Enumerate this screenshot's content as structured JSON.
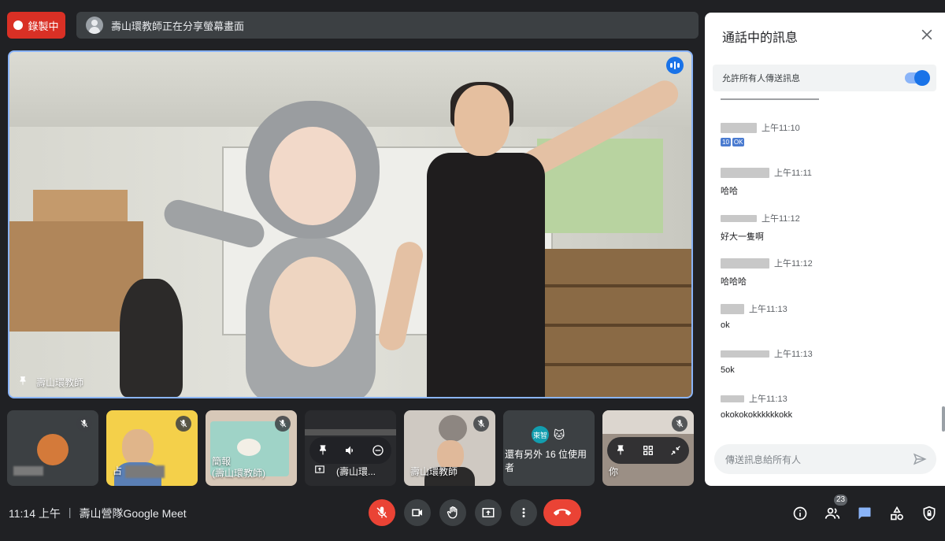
{
  "recording": {
    "label": "錄製中"
  },
  "share_banner": {
    "text": "壽山環教師正在分享螢幕畫面"
  },
  "main_video": {
    "participant": "壽山環教師"
  },
  "thumbnails": [
    {
      "label": ""
    },
    {
      "label": "占"
    },
    {
      "label": "簡報\n(壽山環教師)",
      "line1": "簡報",
      "line2": "(壽山環教師)"
    },
    {
      "label": "(壽山環..."
    },
    {
      "label": "壽山環教師"
    },
    {
      "avatar_text": "東智",
      "text": "還有另外 16 位使用者"
    },
    {
      "label": "你"
    }
  ],
  "meeting": {
    "time": "11:14 上午",
    "name": "壽山營隊Google Meet"
  },
  "participant_count": "23",
  "chat": {
    "title": "通話中的訊息",
    "allow_label": "允許所有人傳送訊息",
    "messages": [
      {
        "time": "上午11:10",
        "text": "10 OK",
        "badges": [
          "10",
          "OK"
        ]
      },
      {
        "time": "上午11:11",
        "text": "哈哈"
      },
      {
        "time": "上午11:12",
        "text": "好大一隻啊"
      },
      {
        "time": "上午11:12",
        "text": "哈哈哈"
      },
      {
        "time": "上午11:13",
        "text": "ok"
      },
      {
        "time": "上午11:13",
        "text": "5ok"
      },
      {
        "time": "上午11:13",
        "text": "okokokokkkkkkokk"
      }
    ],
    "input_placeholder": "傳送訊息給所有人"
  },
  "colors": {
    "accent": "#1a73e8",
    "danger": "#ea4335",
    "recording": "#d93025",
    "background": "#202124"
  }
}
